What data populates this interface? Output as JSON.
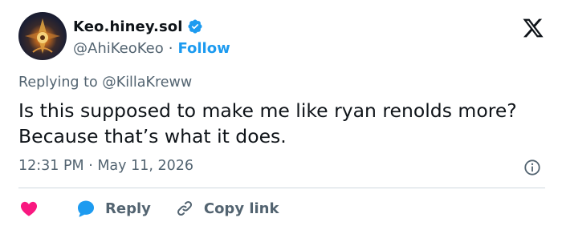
{
  "author": {
    "display_name": "Keo.hiney.sol",
    "handle": "@AhiKeoKeo",
    "separator": "·",
    "follow_label": "Follow"
  },
  "tweet": {
    "replying_to": "Replying to @KillaKreww",
    "text": "Is this supposed to make me like ryan renolds more? Because that’s what it does.",
    "timestamp": "12:31 PM · May 11, 2026"
  },
  "actions": {
    "reply_label": "Reply",
    "copy_link_label": "Copy link"
  },
  "colors": {
    "accent": "#1d9bf0",
    "like": "#f91880",
    "text_primary": "#0f1419",
    "text_secondary": "#536471"
  },
  "icons": {
    "verified": "verified-badge-icon",
    "brand": "x-logo-icon",
    "info": "info-icon",
    "like": "heart-icon",
    "reply": "chat-bubble-icon",
    "copy_link": "link-icon"
  }
}
